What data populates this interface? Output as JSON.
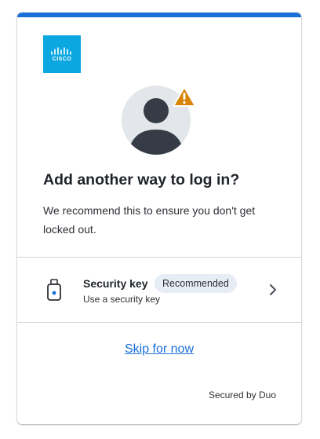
{
  "brand": {
    "logo_text": "CISCO",
    "logo_color": "#0ba7e0",
    "accent_color": "#1a6ed8"
  },
  "header": {
    "icon": "user-warning-icon"
  },
  "title": "Add another way to log in?",
  "description": "We recommend this to ensure you don't get locked out.",
  "options": [
    {
      "icon": "security-key-icon",
      "title": "Security key",
      "badge": "Recommended",
      "subtitle": "Use a security key",
      "action_icon": "chevron-right-icon"
    }
  ],
  "skip_label": "Skip for now",
  "footer": "Secured by Duo"
}
